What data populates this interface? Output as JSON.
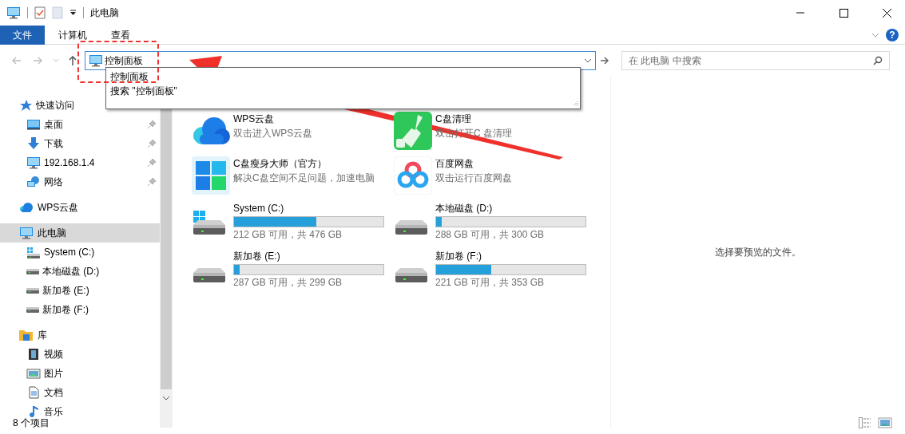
{
  "title_bar": {
    "title": "此电脑"
  },
  "ribbon": {
    "tabs": [
      {
        "label": "文件",
        "kind": "file"
      },
      {
        "label": "计算机",
        "kind": "tab"
      },
      {
        "label": "查看",
        "kind": "tab"
      }
    ],
    "help": "?"
  },
  "address_bar": {
    "value": "控制面板",
    "suggestions": [
      "控制面板",
      "搜索 \"控制面板\""
    ]
  },
  "search": {
    "placeholder": "在 此电脑 中搜索"
  },
  "sidebar": {
    "items": [
      {
        "label": "快速访问",
        "kind": "star",
        "selected": false,
        "children": [
          {
            "label": "桌面",
            "kind": "desktop",
            "pinned": true,
            "selected": false
          },
          {
            "label": "下载",
            "kind": "download",
            "pinned": true,
            "selected": false
          },
          {
            "label": "192.168.1.4",
            "kind": "monitor",
            "pinned": true,
            "selected": false
          },
          {
            "label": "网络",
            "kind": "network",
            "pinned": true,
            "selected": false
          }
        ]
      },
      {
        "label": "WPS云盘",
        "kind": "cloud",
        "selected": false
      },
      {
        "label": "此电脑",
        "kind": "monitor",
        "selected": true,
        "children": [
          {
            "label": "System (C:)",
            "kind": "system",
            "pinned": false,
            "selected": false
          },
          {
            "label": "本地磁盘 (D:)",
            "kind": "drive",
            "pinned": false,
            "selected": false
          },
          {
            "label": "新加卷 (E:)",
            "kind": "drive",
            "pinned": false,
            "selected": false
          },
          {
            "label": "新加卷 (F:)",
            "kind": "drive",
            "pinned": false,
            "selected": false
          }
        ]
      },
      {
        "label": "库",
        "kind": "library",
        "selected": false,
        "children": [
          {
            "label": "视频",
            "kind": "video",
            "pinned": false,
            "selected": false
          },
          {
            "label": "图片",
            "kind": "picture",
            "pinned": false,
            "selected": false
          },
          {
            "label": "文档",
            "kind": "document",
            "pinned": false,
            "selected": false
          },
          {
            "label": "音乐",
            "kind": "music",
            "pinned": false,
            "selected": false
          }
        ]
      }
    ]
  },
  "content": {
    "apps": [
      {
        "title": "WPS云盘",
        "subtitle": "双击进入WPS云盘",
        "kind": "cloud"
      },
      {
        "title": "C盘清理",
        "subtitle": "双击打开C 盘清理",
        "kind": "broom"
      },
      {
        "title": "C盘瘦身大师（官方）",
        "subtitle": "解决C盘空间不足问题，加速电脑",
        "kind": "tiles"
      },
      {
        "title": "百度网盘",
        "subtitle": "双击运行百度网盘",
        "kind": "rings"
      }
    ],
    "drives": [
      {
        "name": "System (C:)",
        "kind": "system",
        "level": 0.55,
        "reading": "212 GB 可用，共 476 GB"
      },
      {
        "name": "本地磁盘 (D:)",
        "kind": "drive",
        "level": 0.04,
        "reading": "288 GB 可用，共 300 GB"
      },
      {
        "name": "新加卷 (E:)",
        "kind": "drive",
        "level": 0.04,
        "reading": "287 GB 可用，共 299 GB"
      },
      {
        "name": "新加卷 (F:)",
        "kind": "drive",
        "level": 0.37,
        "reading": "221 GB 可用，共 353 GB"
      }
    ]
  },
  "preview": {
    "message": "选择要预览的文件。"
  },
  "status_bar": {
    "count": "8 个项目"
  }
}
